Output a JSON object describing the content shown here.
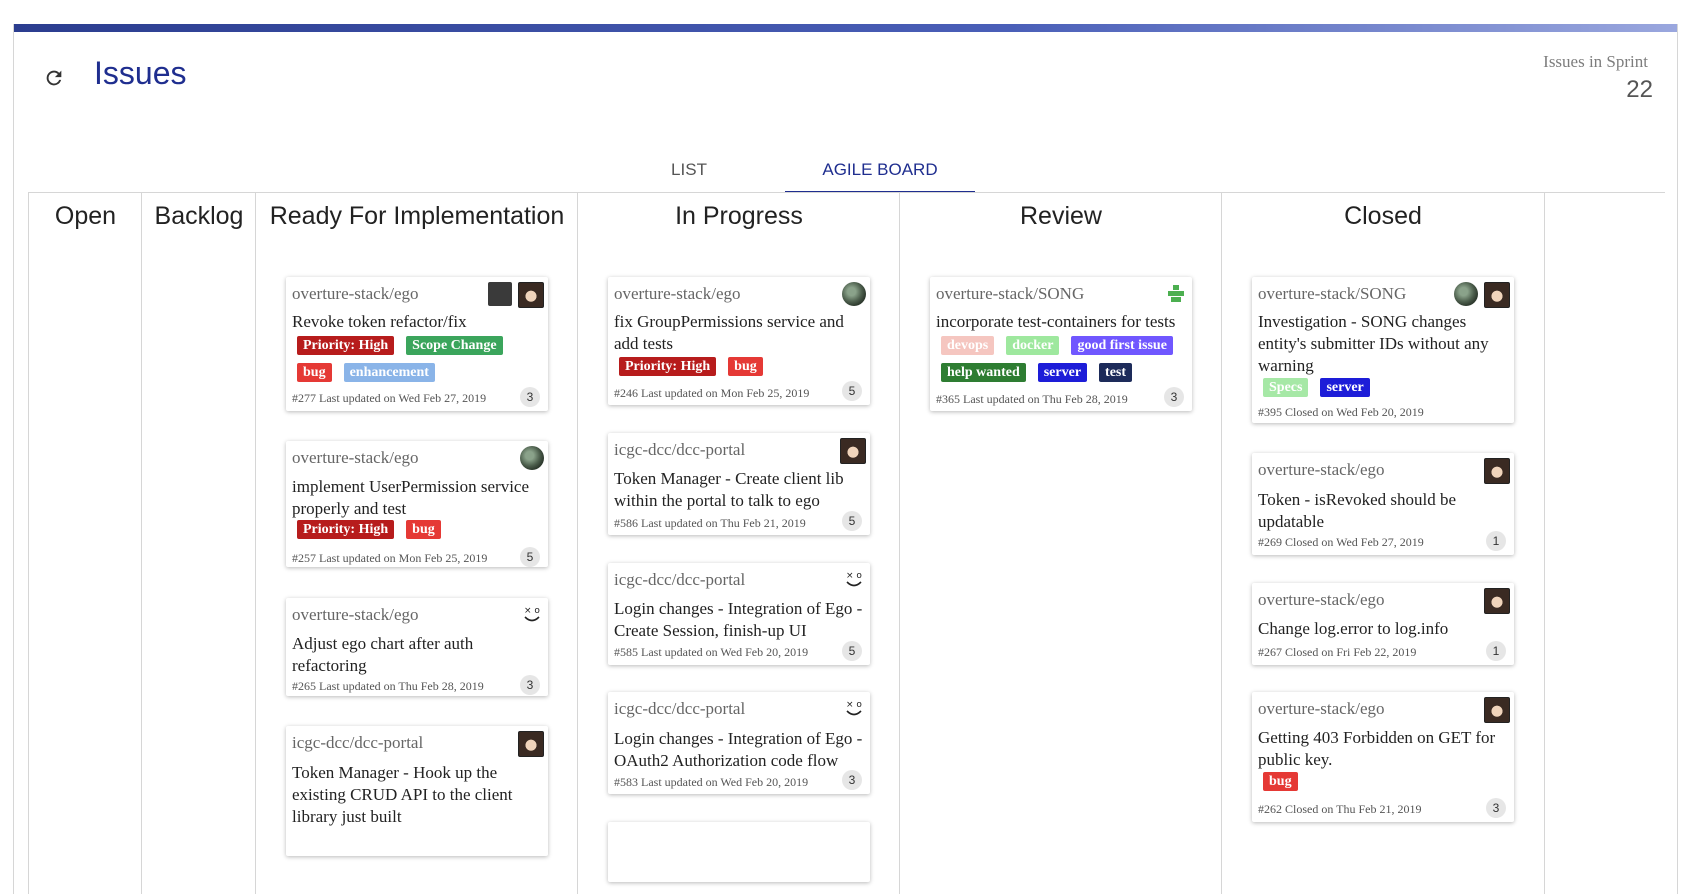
{
  "header": {
    "title": "Issues",
    "refresh_icon": "refresh-icon",
    "sprint_label": "Issues in Sprint",
    "sprint_count": "22",
    "accent": "#1f2e8f"
  },
  "tabs": [
    {
      "label": "LIST",
      "active": false
    },
    {
      "label": "AGILE BOARD",
      "active": true
    }
  ],
  "columns": [
    {
      "title": "Open",
      "cards": []
    },
    {
      "title": "Backlog",
      "cards": []
    },
    {
      "title": "Ready For Implementation",
      "cards": [
        {
          "repo": "overture-stack/ego",
          "title": "Revoke token refactor/fix",
          "labels": [
            {
              "text": "Priority: High",
              "color": "#b71c1c"
            },
            {
              "text": "Scope Change",
              "color": "#3ba55c"
            },
            {
              "text": "bug",
              "color": "#e53935"
            },
            {
              "text": "enhancement",
              "color": "#8ab4e8"
            }
          ],
          "meta": "#277 Last updated on Wed Feb 27, 2019",
          "count": "3",
          "avatars": [
            "photo-avatar",
            "woman-avatar"
          ]
        },
        {
          "repo": "overture-stack/ego",
          "title": "implement UserPermission service properly and test",
          "labels": [
            {
              "text": "Priority: High",
              "color": "#b71c1c"
            },
            {
              "text": "bug",
              "color": "#e53935"
            }
          ],
          "meta": "#257 Last updated on Mon Feb 25, 2019",
          "count": "5",
          "avatars": [
            "globe-avatar"
          ]
        },
        {
          "repo": "overture-stack/ego",
          "title": "Adjust ego chart after auth refactoring",
          "labels": [],
          "meta": "#265 Last updated on Thu Feb 28, 2019",
          "count": "3",
          "avatars": [
            "smile-avatar"
          ]
        },
        {
          "repo": "icgc-dcc/dcc-portal",
          "title": "Token Manager - Hook up the existing CRUD API to the client library just built",
          "labels": [],
          "meta": "",
          "count": "",
          "avatars": [
            "woman-avatar"
          ]
        }
      ]
    },
    {
      "title": "In Progress",
      "cards": [
        {
          "repo": "overture-stack/ego",
          "title": "fix GroupPermissions service and add tests",
          "labels": [
            {
              "text": "Priority: High",
              "color": "#b71c1c"
            },
            {
              "text": "bug",
              "color": "#e53935"
            }
          ],
          "meta": "#246 Last updated on Mon Feb 25, 2019",
          "count": "5",
          "avatars": [
            "globe-avatar"
          ]
        },
        {
          "repo": "icgc-dcc/dcc-portal",
          "title": "Token Manager - Create client lib within the portal to talk to ego",
          "labels": [],
          "meta": "#586 Last updated on Thu Feb 21, 2019",
          "count": "5",
          "avatars": [
            "woman-avatar"
          ]
        },
        {
          "repo": "icgc-dcc/dcc-portal",
          "title": "Login changes - Integration of Ego - Create Session, finish-up UI",
          "labels": [],
          "meta": "#585 Last updated on Wed Feb 20, 2019",
          "count": "5",
          "avatars": [
            "smile-avatar"
          ]
        },
        {
          "repo": "icgc-dcc/dcc-portal",
          "title": "Login changes - Integration of Ego - OAuth2 Authorization code flow",
          "labels": [],
          "meta": "#583 Last updated on Wed Feb 20, 2019",
          "count": "3",
          "avatars": [
            "smile-avatar"
          ]
        }
      ]
    },
    {
      "title": "Review",
      "cards": [
        {
          "repo": "overture-stack/SONG",
          "title": "incorporate test-containers for tests",
          "labels": [
            {
              "text": "devops",
              "color": "#f5c6c0"
            },
            {
              "text": "docker",
              "color": "#9ee89e"
            },
            {
              "text": "good first issue",
              "color": "#7057ff"
            },
            {
              "text": "help wanted",
              "color": "#2e7d32"
            },
            {
              "text": "server",
              "color": "#1d1dd8"
            },
            {
              "text": "test",
              "color": "#1d2b5a"
            }
          ],
          "meta": "#365 Last updated on Thu Feb 28, 2019",
          "count": "3",
          "avatars": [
            "green-avatar"
          ]
        }
      ]
    },
    {
      "title": "Closed",
      "cards": [
        {
          "repo": "overture-stack/SONG",
          "title": "Investigation - SONG changes entity's submitter IDs without any warning",
          "labels": [
            {
              "text": "Specs",
              "color": "#a6e8a6"
            },
            {
              "text": "server",
              "color": "#1d1dd8"
            }
          ],
          "meta": "#395 Closed on Wed Feb 20, 2019",
          "count": "",
          "avatars": [
            "globe-avatar",
            "woman-avatar"
          ]
        },
        {
          "repo": "overture-stack/ego",
          "title": "Token - isRevoked should be updatable",
          "labels": [],
          "meta": "#269 Closed on Wed Feb 27, 2019",
          "count": "1",
          "avatars": [
            "woman-avatar"
          ]
        },
        {
          "repo": "overture-stack/ego",
          "title": "Change log.error to log.info",
          "labels": [],
          "meta": "#267 Closed on Fri Feb 22, 2019",
          "count": "1",
          "avatars": [
            "woman-avatar"
          ]
        },
        {
          "repo": "overture-stack/ego",
          "title": "Getting 403 Forbidden on GET for public key.",
          "labels": [
            {
              "text": "bug",
              "color": "#e53935"
            }
          ],
          "meta": "#262 Closed on Thu Feb 21, 2019",
          "count": "3",
          "avatars": [
            "woman-avatar"
          ]
        }
      ]
    }
  ]
}
